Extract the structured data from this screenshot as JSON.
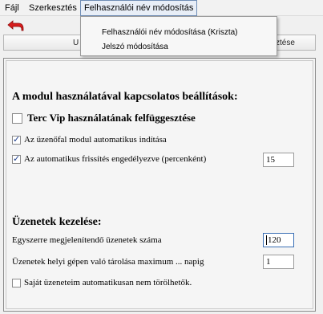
{
  "menu": {
    "file": "Fájl",
    "edit": "Szerkesztés",
    "user": "Felhasználói név módosítás"
  },
  "dropdown": {
    "items": [
      "Felhasználói név módosítása (Kriszta)",
      "Jelszó módosítása"
    ]
  },
  "tabs": {
    "tab1_visible": "U",
    "tab2_visible": "sztése"
  },
  "module_section": {
    "title": "A modul használatával kapcsolatos beállítások:",
    "suspend_label": "Terc Vip használatának felfüggesztése",
    "suspend_checked": false,
    "autostart_label": "Az üzenőfal modul automatikus indítása",
    "autostart_checked": true,
    "autorefresh_label": "Az automatikus frissítés engedélyezve (percenként)",
    "autorefresh_checked": true,
    "autorefresh_value": "15"
  },
  "messages_section": {
    "title": "Üzenetek kezelése:",
    "count_label": "Egyszerre megjelenítendő üzenetek száma",
    "count_value": "120",
    "storage_label": "Üzenetek helyi gépen való tárolása maximum ... napig",
    "storage_value": "1",
    "own_label": "Saját üzeneteim automatikusan nem törölhetők.",
    "own_checked": false
  },
  "colors": {
    "back_arrow": "#d61c1c",
    "menu_active_border": "#6f8db5"
  }
}
